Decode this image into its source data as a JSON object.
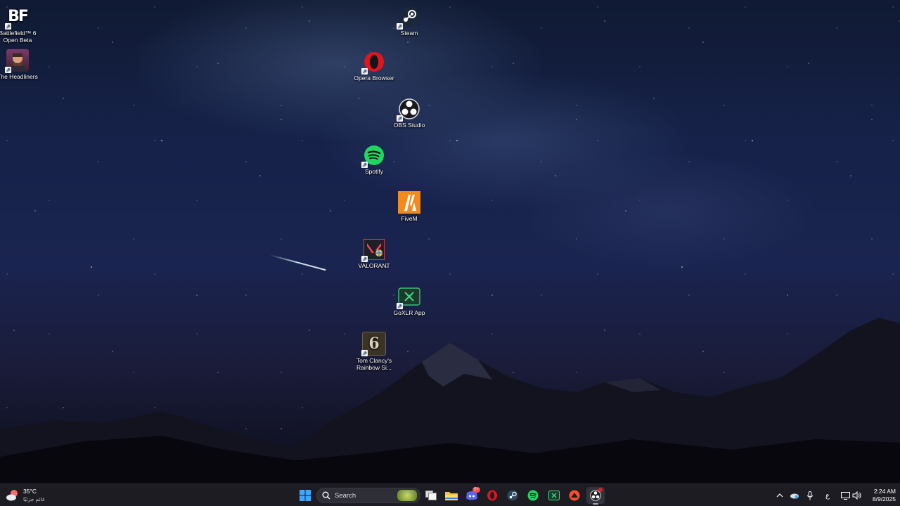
{
  "desktop": {
    "icons": [
      {
        "label": "Battlefield™ 6 Open Beta",
        "icon": "battlefield-icon"
      },
      {
        "label": "The Headliners",
        "icon": "headliners-icon"
      },
      {
        "label": "Steam",
        "icon": "steam-icon"
      },
      {
        "label": "Opera Browser",
        "icon": "opera-icon"
      },
      {
        "label": "OBS Studio",
        "icon": "obs-icon"
      },
      {
        "label": "Spotify",
        "icon": "spotify-icon"
      },
      {
        "label": "FiveM",
        "icon": "fivem-icon"
      },
      {
        "label": "VALORANT",
        "icon": "valorant-icon"
      },
      {
        "label": "GoXLR App",
        "icon": "goxlr-icon"
      },
      {
        "label": "Tom Clancy's Rainbow Si...",
        "icon": "rainbow-six-icon"
      }
    ],
    "bf_glyph": "BF",
    "r6_glyph": "6"
  },
  "taskbar": {
    "weather": {
      "temp": "35°C",
      "desc": "غائم جزئيًا"
    },
    "search_placeholder": "Search",
    "discord_badge": "5+",
    "tray": {
      "input_indicator": "ع",
      "time": "2:24 AM",
      "date": "8/9/2025"
    }
  },
  "colors": {
    "taskbar_bg": "#1c1c22",
    "accent_windows": "#3fa7ff",
    "spotify": "#1ed760",
    "opera": "#e0151f",
    "fivem": "#f28b1b",
    "steam": "#1b2838"
  }
}
